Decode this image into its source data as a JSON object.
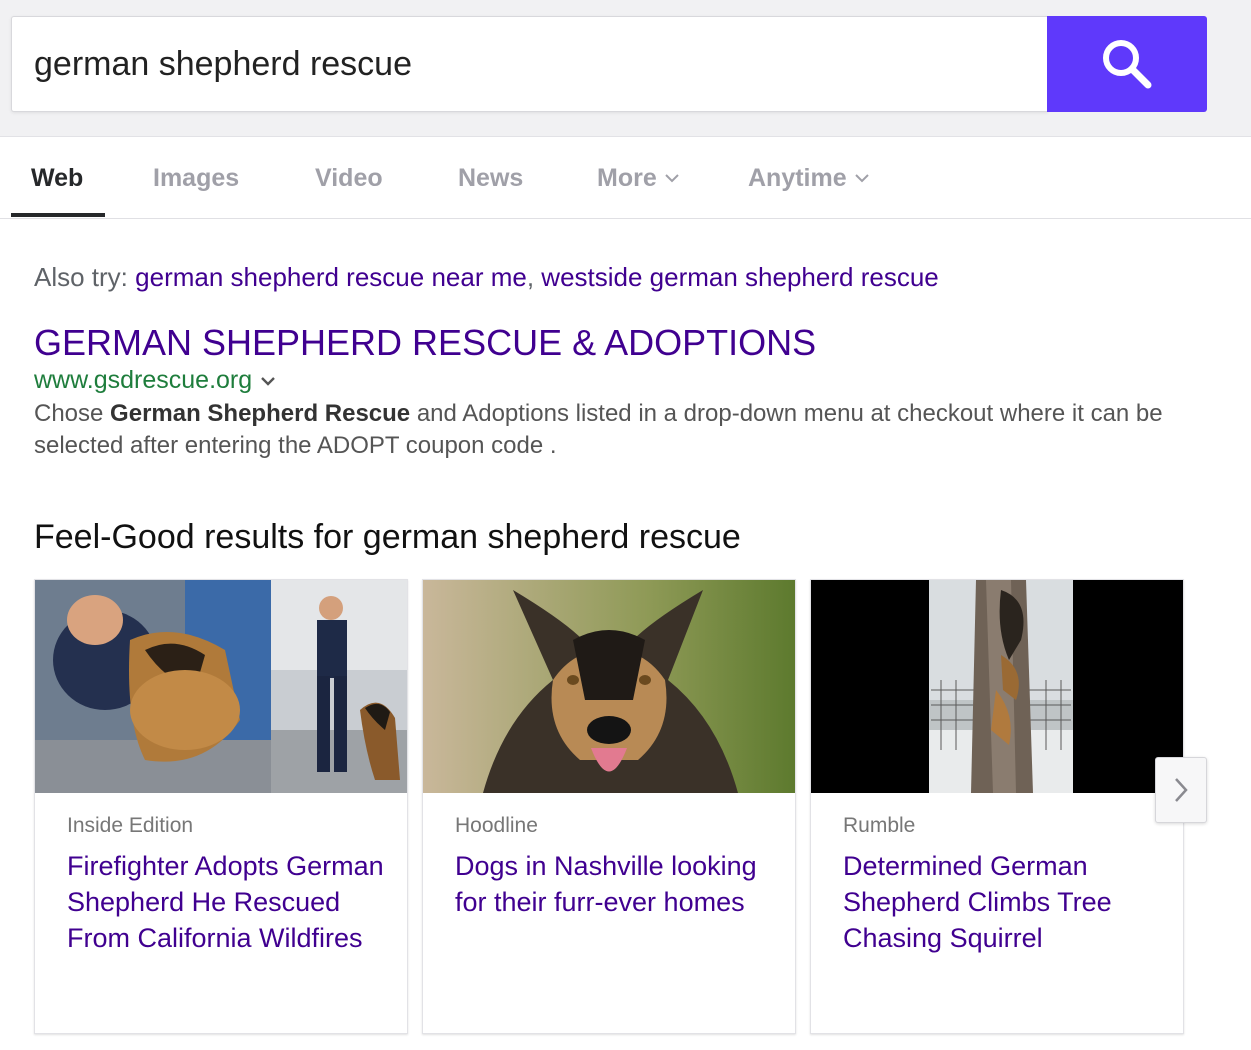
{
  "search": {
    "query": "german shepherd rescue",
    "button_icon": "search-icon",
    "button_color": "#5f39fb"
  },
  "tabs": [
    {
      "label": "Web",
      "active": true
    },
    {
      "label": "Images"
    },
    {
      "label": "Video"
    },
    {
      "label": "News"
    },
    {
      "label": "More",
      "icon": "chevron-down-icon"
    },
    {
      "label": "Anytime",
      "icon": "chevron-down-icon"
    }
  ],
  "also_try": {
    "prefix": "Also try:",
    "links": [
      "german shepherd rescue near me",
      "westside german shepherd rescue"
    ],
    "separator": ","
  },
  "result": {
    "title": "GERMAN SHEPHERD RESCUE & ADOPTIONS",
    "url": "www.gsdrescue.org",
    "url_icon": "chevron-down-icon",
    "desc_before": "Chose ",
    "desc_bold": "German Shepherd Rescue",
    "desc_after": " and Adoptions listed in a drop-down menu at checkout where it can be selected after entering the ADOPT coupon code ."
  },
  "feel_good": {
    "heading": "Feel-Good results for german shepherd rescue",
    "cards": [
      {
        "source": "Inside Edition",
        "headline": "Firefighter Adopts German Shepherd He Rescued From California Wildfires"
      },
      {
        "source": "Hoodline",
        "headline": "Dogs in Nashville looking for their furr-ever homes"
      },
      {
        "source": "Rumble",
        "headline": "Determined German Shepherd Climbs Tree Chasing Squirrel"
      }
    ],
    "next_icon": "chevron-right-icon"
  },
  "colors": {
    "link": "#400090",
    "url": "#1e7d3c",
    "accent": "#5f39fb"
  }
}
